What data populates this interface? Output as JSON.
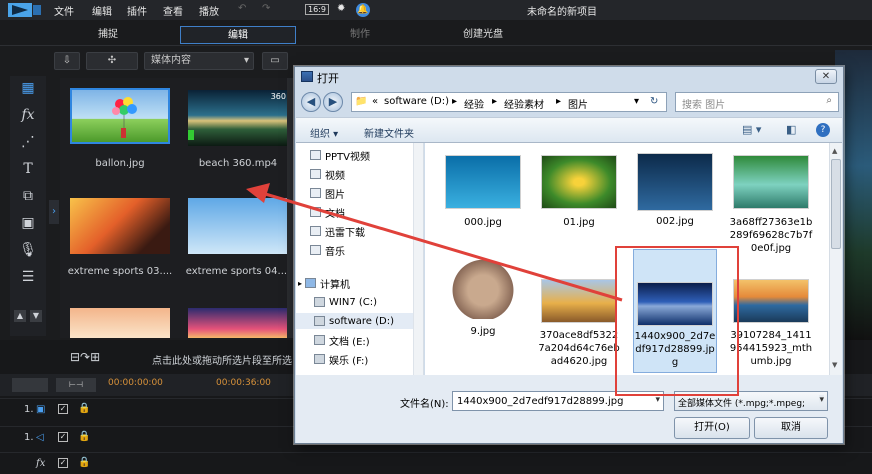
{
  "app": {
    "menu": [
      "文件",
      "编辑",
      "插件",
      "查看",
      "播放"
    ],
    "zoom": "16:9",
    "title": "未命名的新项目",
    "tabs": [
      "捕捉",
      "编辑",
      "制作",
      "创建光盘"
    ],
    "active_tab": "编辑",
    "library_dropdown": "媒体内容",
    "library_search": "搜索库",
    "side_tools": [
      "media-icon",
      "fx-icon",
      "particle-icon",
      "title-icon",
      "transition-icon",
      "pip-icon",
      "audio-icon",
      "chapter-icon"
    ],
    "thumbs": [
      {
        "label": "ballon.jpg"
      },
      {
        "label": "beach 360.mp4",
        "badge": "360"
      },
      {
        "label": "extreme sports 03...."
      },
      {
        "label": "extreme sports 04...."
      }
    ],
    "timeline": {
      "hint": "点击此处或拖动所选片段至所选",
      "times": [
        "00:00:00:00",
        "00:00:36:00"
      ],
      "tracks": [
        "1.",
        "1.",
        "fx"
      ]
    }
  },
  "dialog": {
    "title": "打开",
    "address": [
      "software (D:)",
      "经验",
      "经验素材",
      "图片"
    ],
    "search_placeholder": "搜索 图片",
    "organize": "组织 ▾",
    "new_folder": "新建文件夹",
    "tree": [
      "PPTV视频",
      "视频",
      "图片",
      "文档",
      "迅雷下载",
      "音乐",
      "计算机",
      "WIN7 (C:)",
      "software (D:)",
      "文档 (E:)",
      "娱乐 (F:)"
    ],
    "files": [
      {
        "name": "000.jpg"
      },
      {
        "name": "01.jpg"
      },
      {
        "name": "002.jpg"
      },
      {
        "name": "3a68ff27363e1b289f69628c7b7f0e0f.jpg"
      },
      {
        "name": "9.jpg"
      },
      {
        "name": "370ace8df53227a204d64c76eb ad4620.jpg"
      },
      {
        "name": "1440x900_2d7edf917d28899.jpg",
        "selected": true
      },
      {
        "name": "39107284_1411954415923_mthumb.jpg"
      }
    ],
    "filename_label": "文件名(N):",
    "filename_value": "1440x900_2d7edf917d28899.jpg",
    "filetype_value": "全部媒体文件 (*.mpg;*.mpeg;",
    "open_button": "打开(O)",
    "cancel_button": "取消"
  },
  "colors": {
    "annotation_red": "#e0413a",
    "selection_blue": "#cfe4f7",
    "editor_bg": "#1b1c1e"
  }
}
